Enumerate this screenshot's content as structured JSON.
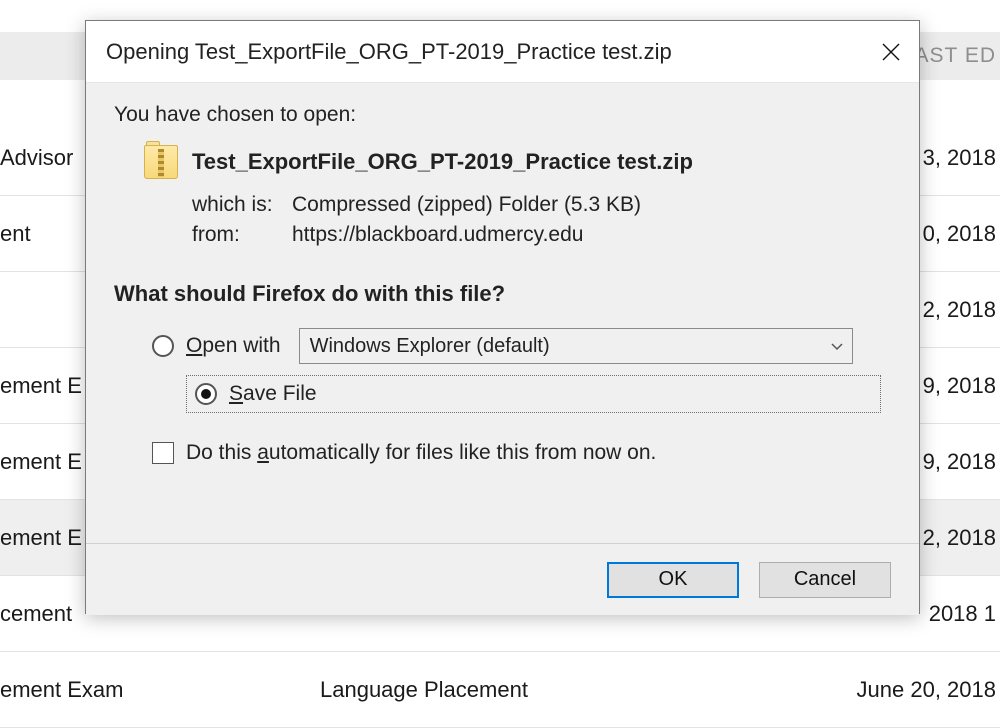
{
  "background": {
    "header_col3": "AST ED",
    "rows": [
      {
        "c1": "Advisor",
        "c2": "",
        "c3": "3, 2018",
        "selected": false
      },
      {
        "c1": "ent",
        "c2": "",
        "c3": "0, 2018",
        "selected": false
      },
      {
        "c1": "",
        "c2": "",
        "c3": "2, 2018",
        "selected": false
      },
      {
        "c1": "ement E",
        "c2": "",
        "c3": "9, 2018",
        "selected": false
      },
      {
        "c1": "ement E",
        "c2": "",
        "c3": "9, 2018",
        "selected": false
      },
      {
        "c1": "ement E",
        "c2": "",
        "c3": "2, 2018",
        "selected": true
      },
      {
        "c1": "cement",
        "c2": "",
        "c3": "2018 1",
        "selected": false
      },
      {
        "c1": "ement Exam",
        "c2": "Language Placement",
        "c3": "June 20, 2018",
        "selected": false
      }
    ]
  },
  "dialog": {
    "title": "Opening Test_ExportFile_ORG_PT-2019_Practice test.zip",
    "chosen_text": "You have chosen to open:",
    "filename": "Test_ExportFile_ORG_PT-2019_Practice test.zip",
    "which_is_label": "which is:",
    "which_is_value": "Compressed (zipped) Folder (5.3 KB)",
    "from_label": "from:",
    "from_value": "https://blackboard.udmercy.edu",
    "question": "What should Firefox do with this file?",
    "open_with_prefix": "O",
    "open_with_rest": "pen with",
    "open_with_app": "Windows Explorer (default)",
    "save_file_prefix": "S",
    "save_file_rest": "ave File",
    "auto_prefix": "Do this ",
    "auto_underline": "a",
    "auto_rest": "utomatically for files like this from now on.",
    "ok_label": "OK",
    "cancel_label": "Cancel"
  }
}
